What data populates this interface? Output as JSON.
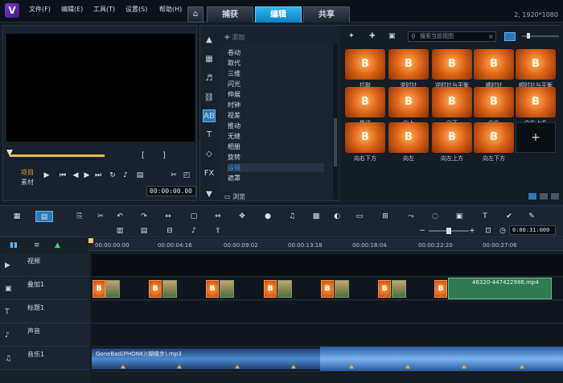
{
  "menu": {
    "items": [
      "文件(F)",
      "编辑(E)",
      "工具(T)",
      "设置(S)",
      "帮助(H)"
    ]
  },
  "tabs": {
    "capture": "捕获",
    "edit": "编辑",
    "share": "共享"
  },
  "resolution": "2, 1920*1080",
  "preview": {
    "project_label": "项目",
    "clip_label": "素材",
    "timecode": "00:00:00.00",
    "bracket_in": "[",
    "bracket_out": "]"
  },
  "library": {
    "add_label": "添加",
    "categories": [
      "卷动",
      "取代",
      "三维",
      "闪光",
      "伸展",
      "时钟",
      "视差",
      "推动",
      "无缝",
      "相册",
      "旋转",
      "运镜",
      "遮罩"
    ],
    "selected": "运镜",
    "browse_label": "浏览",
    "search_placeholder": "搜索当前视图",
    "effects": [
      {
        "name": "拉取"
      },
      {
        "name": "逆时针"
      },
      {
        "name": "逆时针与平衡"
      },
      {
        "name": "顺时针"
      },
      {
        "name": "顺时针与平衡"
      },
      {
        "name": "推送"
      },
      {
        "name": "向上"
      },
      {
        "name": "向下"
      },
      {
        "name": "向右"
      },
      {
        "name": "向右上方"
      },
      {
        "name": "向右下方"
      },
      {
        "name": "向左"
      },
      {
        "name": "向左上方"
      },
      {
        "name": "向左下方"
      }
    ],
    "add_tile": "+"
  },
  "timeline": {
    "timecode": "0:00:31:000",
    "ruler": [
      "00:00:00:00",
      "00:00:04:16",
      "00:00:09:02",
      "00:00:13:18",
      "00:00:18:04",
      "00:00:22:20",
      "00:00:27:06"
    ],
    "tracks": [
      {
        "name": "视频",
        "icon": "video-icon"
      },
      {
        "name": "叠加1",
        "icon": "overlay-icon"
      },
      {
        "name": "标题1",
        "icon": "title-icon"
      },
      {
        "name": "声音",
        "icon": "voice-icon"
      },
      {
        "name": "音乐1",
        "icon": "music-icon"
      }
    ],
    "overlay_clip": "46320-447422988.mp4",
    "music_clip": "GoneBad(PHONK)(蝴蝶步).mp3"
  },
  "colors": {
    "accent": "#1e9be0",
    "orange": "#e0681a",
    "bg": "#141c26"
  }
}
